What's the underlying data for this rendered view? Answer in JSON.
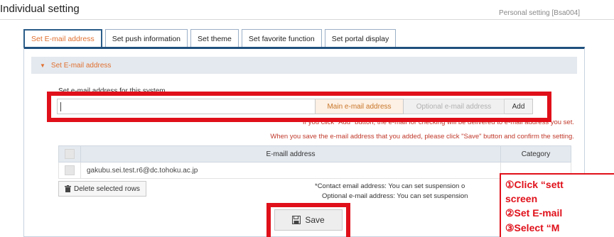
{
  "header": {
    "title": "Individual setting",
    "screen_id": "Personal setting [Bsa004]"
  },
  "tabs": [
    {
      "label": "Set E-mail address",
      "active": true
    },
    {
      "label": "Set push information",
      "active": false
    },
    {
      "label": "Set theme",
      "active": false
    },
    {
      "label": "Set favorite function",
      "active": false
    },
    {
      "label": "Set portal display",
      "active": false
    }
  ],
  "section": {
    "title": "Set E-mail address"
  },
  "form": {
    "label": "Set e-mail address for this system.",
    "email_value": "",
    "main_label": "Main e-mail address",
    "optional_label": "Optional e-mail address",
    "add_label": "Add",
    "note1": "*If you click \"Add\" button, the e-mail for checking will be delivered to e-mail address you set.",
    "note2": "When you save the e-mail address that you added, please click \"Save\" button and confirm the setting."
  },
  "table": {
    "header": "E-maill address",
    "header_right": "Category",
    "rows": [
      {
        "email": "gakubu.sei.test.r6@dc.tohoku.ac.jp"
      }
    ]
  },
  "delete_label": "Delete selected rows",
  "contact": {
    "line1": "*Contact email address:  You can set suspension o",
    "line2": "Optional e-mail address:  You can set suspension"
  },
  "save_label": "Save",
  "callout": {
    "line1": "①Click “sett",
    "line2": "screen",
    "line3": "②Set E-mail",
    "line4": "③Select “M"
  },
  "colors": {
    "accent": "#e07030",
    "tab_border": "#2b5d8a",
    "highlight": "#e0101a",
    "note": "#c0392b"
  },
  "icons": {
    "section_caret": "caret-down-icon",
    "delete": "trash-icon",
    "save": "floppy-disk-icon"
  }
}
